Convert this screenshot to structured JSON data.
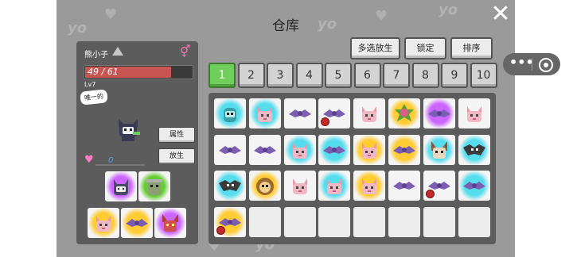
{
  "window": {
    "title": "仓库",
    "close_icon": "close-icon"
  },
  "toolbar": {
    "multi_release": "多选放生",
    "lock": "锁定",
    "sort": "排序"
  },
  "tabs": [
    {
      "label": "1",
      "active": true
    },
    {
      "label": "2",
      "active": false
    },
    {
      "label": "3",
      "active": false
    },
    {
      "label": "4",
      "active": false
    },
    {
      "label": "5",
      "active": false
    },
    {
      "label": "6",
      "active": false
    },
    {
      "label": "7",
      "active": false
    },
    {
      "label": "8",
      "active": false
    },
    {
      "label": "9",
      "active": false
    },
    {
      "label": "10",
      "active": false
    }
  ],
  "pet": {
    "name": "熊小子",
    "gender_icon": "female-icon",
    "hp_text": "49 / 61",
    "hp_current": 49,
    "hp_max": 61,
    "level": "Lv7",
    "badge": "唯一的",
    "attributes_button": "属性",
    "release_button": "放生",
    "affection_value": "0",
    "affection_icon": "heart-icon"
  },
  "party": [
    {
      "kind": "cat",
      "bg": "#cc66ff"
    },
    {
      "kind": "goblin",
      "bg": "#66cc33"
    },
    {
      "kind": "fox",
      "bg": "#ffcc33"
    },
    {
      "kind": "bat",
      "bg": "#ffcc33"
    },
    {
      "kind": "imp",
      "bg": "#cc66ff"
    }
  ],
  "storage": [
    {
      "kind": "frog",
      "bg": "#55ddee",
      "item": false
    },
    {
      "kind": "fox",
      "bg": "#55ddee",
      "item": false
    },
    {
      "kind": "bat",
      "bg": "#f4f4f4",
      "item": false
    },
    {
      "kind": "bat",
      "bg": "#f4f4f4",
      "item": true
    },
    {
      "kind": "fox",
      "bg": "#f4f4f4",
      "item": false
    },
    {
      "kind": "flower",
      "bg": "#ffcc33",
      "item": false
    },
    {
      "kind": "bat",
      "bg": "#cc66ff",
      "item": false
    },
    {
      "kind": "fox",
      "bg": "#f4f4f4",
      "item": false
    },
    {
      "kind": "bat",
      "bg": "#f4f4f4",
      "item": false
    },
    {
      "kind": "bat",
      "bg": "#f4f4f4",
      "item": false
    },
    {
      "kind": "fox",
      "bg": "#55ddee",
      "item": false
    },
    {
      "kind": "bat",
      "bg": "#55ddee",
      "item": false
    },
    {
      "kind": "fox",
      "bg": "#ffcc33",
      "item": false
    },
    {
      "kind": "bat",
      "bg": "#ffcc33",
      "item": false
    },
    {
      "kind": "dog",
      "bg": "#55ddee",
      "item": false
    },
    {
      "kind": "darkbat",
      "bg": "#55ddee",
      "item": false
    },
    {
      "kind": "darkbat",
      "bg": "#55ddee",
      "item": false
    },
    {
      "kind": "monkey",
      "bg": "#ffcc33",
      "item": false
    },
    {
      "kind": "fox",
      "bg": "#f4f4f4",
      "item": false
    },
    {
      "kind": "fox",
      "bg": "#55ddee",
      "item": false
    },
    {
      "kind": "fox",
      "bg": "#ffcc33",
      "item": false
    },
    {
      "kind": "bat",
      "bg": "#f4f4f4",
      "item": false
    },
    {
      "kind": "bat",
      "bg": "#f4f4f4",
      "item": true
    },
    {
      "kind": "bat",
      "bg": "#55ddee",
      "item": false
    },
    {
      "kind": "bat",
      "bg": "#ffcc33",
      "item": true
    },
    {
      "kind": "empty"
    },
    {
      "kind": "empty"
    },
    {
      "kind": "empty"
    },
    {
      "kind": "empty"
    },
    {
      "kind": "empty"
    },
    {
      "kind": "empty"
    },
    {
      "kind": "empty"
    }
  ],
  "side_controls": {
    "more_icon": "more-icon",
    "target_icon": "target-icon"
  },
  "colors": {
    "accent_tab": "#6fcf5a",
    "hp_fill": "#c95552",
    "panel": "#5c5c5c",
    "backdrop": "#9a9a9a"
  }
}
